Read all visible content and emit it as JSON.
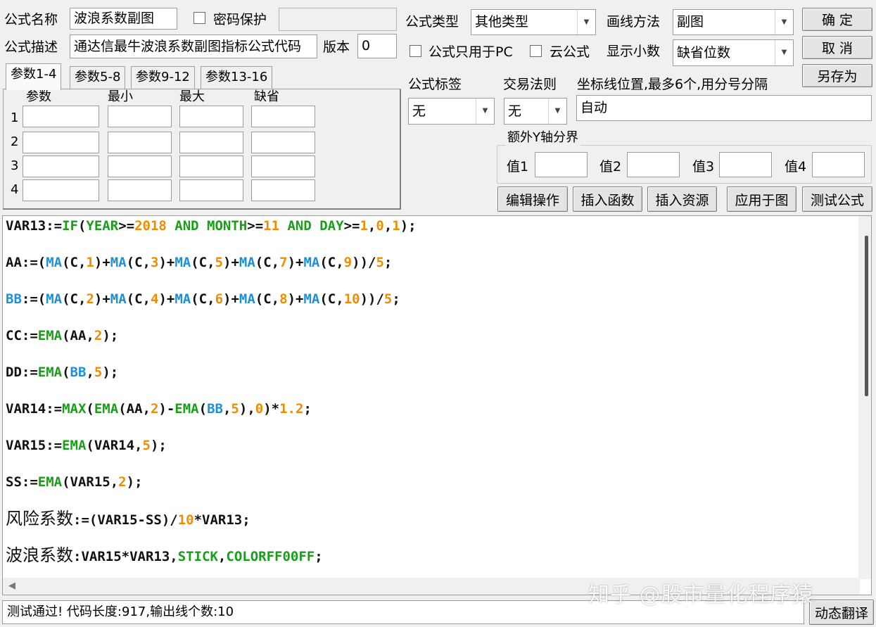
{
  "form": {
    "name_label": "公式名称",
    "name_value": "波浪系数副图",
    "password_label": "密码保护",
    "password_value": "",
    "desc_label": "公式描述",
    "desc_value": "通达信最牛波浪系数副图指标公式代码",
    "version_label": "版本",
    "version_value": "0",
    "type_label": "公式类型",
    "type_value": "其他类型",
    "draw_label": "画线方法",
    "draw_value": "副图",
    "pc_only_label": "公式只用于PC",
    "cloud_label": "云公式",
    "decimals_label": "显示小数",
    "decimals_value": "缺省位数",
    "tag_label": "公式标签",
    "tag_value": "无",
    "rule_label": "交易法则",
    "rule_value": "无",
    "coord_label": "坐标线位置,最多6个,用分号分隔",
    "coord_value": "自动"
  },
  "buttons": {
    "ok": "确  定",
    "cancel": "取  消",
    "save_as": "另存为",
    "edit_ops": "编辑操作",
    "insert_func": "插入函数",
    "insert_resource": "插入资源",
    "apply_chart": "应用于图",
    "test_formula": "测试公式",
    "dynamic_translate": "动态翻译"
  },
  "tabs": [
    "参数1-4",
    "参数5-8",
    "参数9-12",
    "参数13-16"
  ],
  "params": {
    "headers": [
      "参数",
      "最小",
      "最大",
      "缺省"
    ],
    "rows": [
      "1",
      "2",
      "3",
      "4"
    ]
  },
  "yaxis": {
    "title": "额外Y轴分界",
    "labels": [
      "值1",
      "值2",
      "值3",
      "值4"
    ]
  },
  "colors": {
    "keyword": "#1a9e1a",
    "number": "#f08c00",
    "func": "#1f8fd6",
    "text": "#111111"
  },
  "code_lines": [
    [
      [
        "VAR13:=",
        "t"
      ],
      [
        "IF",
        "k"
      ],
      [
        "(",
        "t"
      ],
      [
        "YEAR",
        "k"
      ],
      [
        ">=",
        "t"
      ],
      [
        "2018",
        "n"
      ],
      [
        " AND ",
        "k"
      ],
      [
        "MONTH",
        "k"
      ],
      [
        ">=",
        "t"
      ],
      [
        "11",
        "n"
      ],
      [
        " AND ",
        "k"
      ],
      [
        "DAY",
        "k"
      ],
      [
        ">=",
        "t"
      ],
      [
        "1",
        "n"
      ],
      [
        ",",
        "t"
      ],
      [
        "0",
        "n"
      ],
      [
        ",",
        "t"
      ],
      [
        "1",
        "n"
      ],
      [
        ");",
        "t"
      ]
    ],
    [
      [
        "AA:=(",
        "t"
      ],
      [
        "MA",
        "f"
      ],
      [
        "(C,",
        "t"
      ],
      [
        "1",
        "n"
      ],
      [
        ")+",
        "t"
      ],
      [
        "MA",
        "f"
      ],
      [
        "(C,",
        "t"
      ],
      [
        "3",
        "n"
      ],
      [
        ")+",
        "t"
      ],
      [
        "MA",
        "f"
      ],
      [
        "(C,",
        "t"
      ],
      [
        "5",
        "n"
      ],
      [
        ")+",
        "t"
      ],
      [
        "MA",
        "f"
      ],
      [
        "(C,",
        "t"
      ],
      [
        "7",
        "n"
      ],
      [
        ")+",
        "t"
      ],
      [
        "MA",
        "f"
      ],
      [
        "(C,",
        "t"
      ],
      [
        "9",
        "n"
      ],
      [
        "))/",
        "t"
      ],
      [
        "5",
        "n"
      ],
      [
        ";",
        "t"
      ]
    ],
    [
      [
        "BB",
        "f"
      ],
      [
        ":=(",
        "t"
      ],
      [
        "MA",
        "f"
      ],
      [
        "(C,",
        "t"
      ],
      [
        "2",
        "n"
      ],
      [
        ")+",
        "t"
      ],
      [
        "MA",
        "f"
      ],
      [
        "(C,",
        "t"
      ],
      [
        "4",
        "n"
      ],
      [
        ")+",
        "t"
      ],
      [
        "MA",
        "f"
      ],
      [
        "(C,",
        "t"
      ],
      [
        "6",
        "n"
      ],
      [
        ")+",
        "t"
      ],
      [
        "MA",
        "f"
      ],
      [
        "(C,",
        "t"
      ],
      [
        "8",
        "n"
      ],
      [
        ")+",
        "t"
      ],
      [
        "MA",
        "f"
      ],
      [
        "(C,",
        "t"
      ],
      [
        "10",
        "n"
      ],
      [
        "))/",
        "t"
      ],
      [
        "5",
        "n"
      ],
      [
        ";",
        "t"
      ]
    ],
    [
      [
        "CC:=",
        "t"
      ],
      [
        "EMA",
        "k"
      ],
      [
        "(AA,",
        "t"
      ],
      [
        "2",
        "n"
      ],
      [
        ");",
        "t"
      ]
    ],
    [
      [
        "DD:=",
        "t"
      ],
      [
        "EMA",
        "k"
      ],
      [
        "(",
        "t"
      ],
      [
        "BB",
        "f"
      ],
      [
        ",",
        "t"
      ],
      [
        "5",
        "n"
      ],
      [
        ");",
        "t"
      ]
    ],
    [
      [
        "VAR14:=",
        "t"
      ],
      [
        "MAX",
        "k"
      ],
      [
        "(",
        "t"
      ],
      [
        "EMA",
        "k"
      ],
      [
        "(AA,",
        "t"
      ],
      [
        "2",
        "n"
      ],
      [
        ")-",
        "t"
      ],
      [
        "EMA",
        "k"
      ],
      [
        "(",
        "t"
      ],
      [
        "BB",
        "f"
      ],
      [
        ",",
        "t"
      ],
      [
        "5",
        "n"
      ],
      [
        "),",
        "t"
      ],
      [
        "0",
        "n"
      ],
      [
        ")*",
        "t"
      ],
      [
        "1.2",
        "n"
      ],
      [
        ";",
        "t"
      ]
    ],
    [
      [
        "VAR15:=",
        "t"
      ],
      [
        "EMA",
        "k"
      ],
      [
        "(VAR14,",
        "t"
      ],
      [
        "5",
        "n"
      ],
      [
        ");",
        "t"
      ]
    ],
    [
      [
        "SS:=",
        "t"
      ],
      [
        "EMA",
        "k"
      ],
      [
        "(VAR15,",
        "t"
      ],
      [
        "2",
        "n"
      ],
      [
        ");",
        "t"
      ]
    ],
    [
      [
        "风险系数",
        "c"
      ],
      [
        ":=(VAR15-SS)/",
        "t"
      ],
      [
        "10",
        "n"
      ],
      [
        "*VAR13;",
        "t"
      ]
    ],
    [
      [
        "波浪系数",
        "c"
      ],
      [
        ":VAR15*VAR13,",
        "t"
      ],
      [
        "STICK",
        "k"
      ],
      [
        ",",
        "t"
      ],
      [
        "COLORFF00FF",
        "k"
      ],
      [
        ";",
        "t"
      ]
    ]
  ],
  "status": "测试通过! 代码长度:917,输出线个数:10",
  "watermark": "知乎 @股市量化程序猿"
}
